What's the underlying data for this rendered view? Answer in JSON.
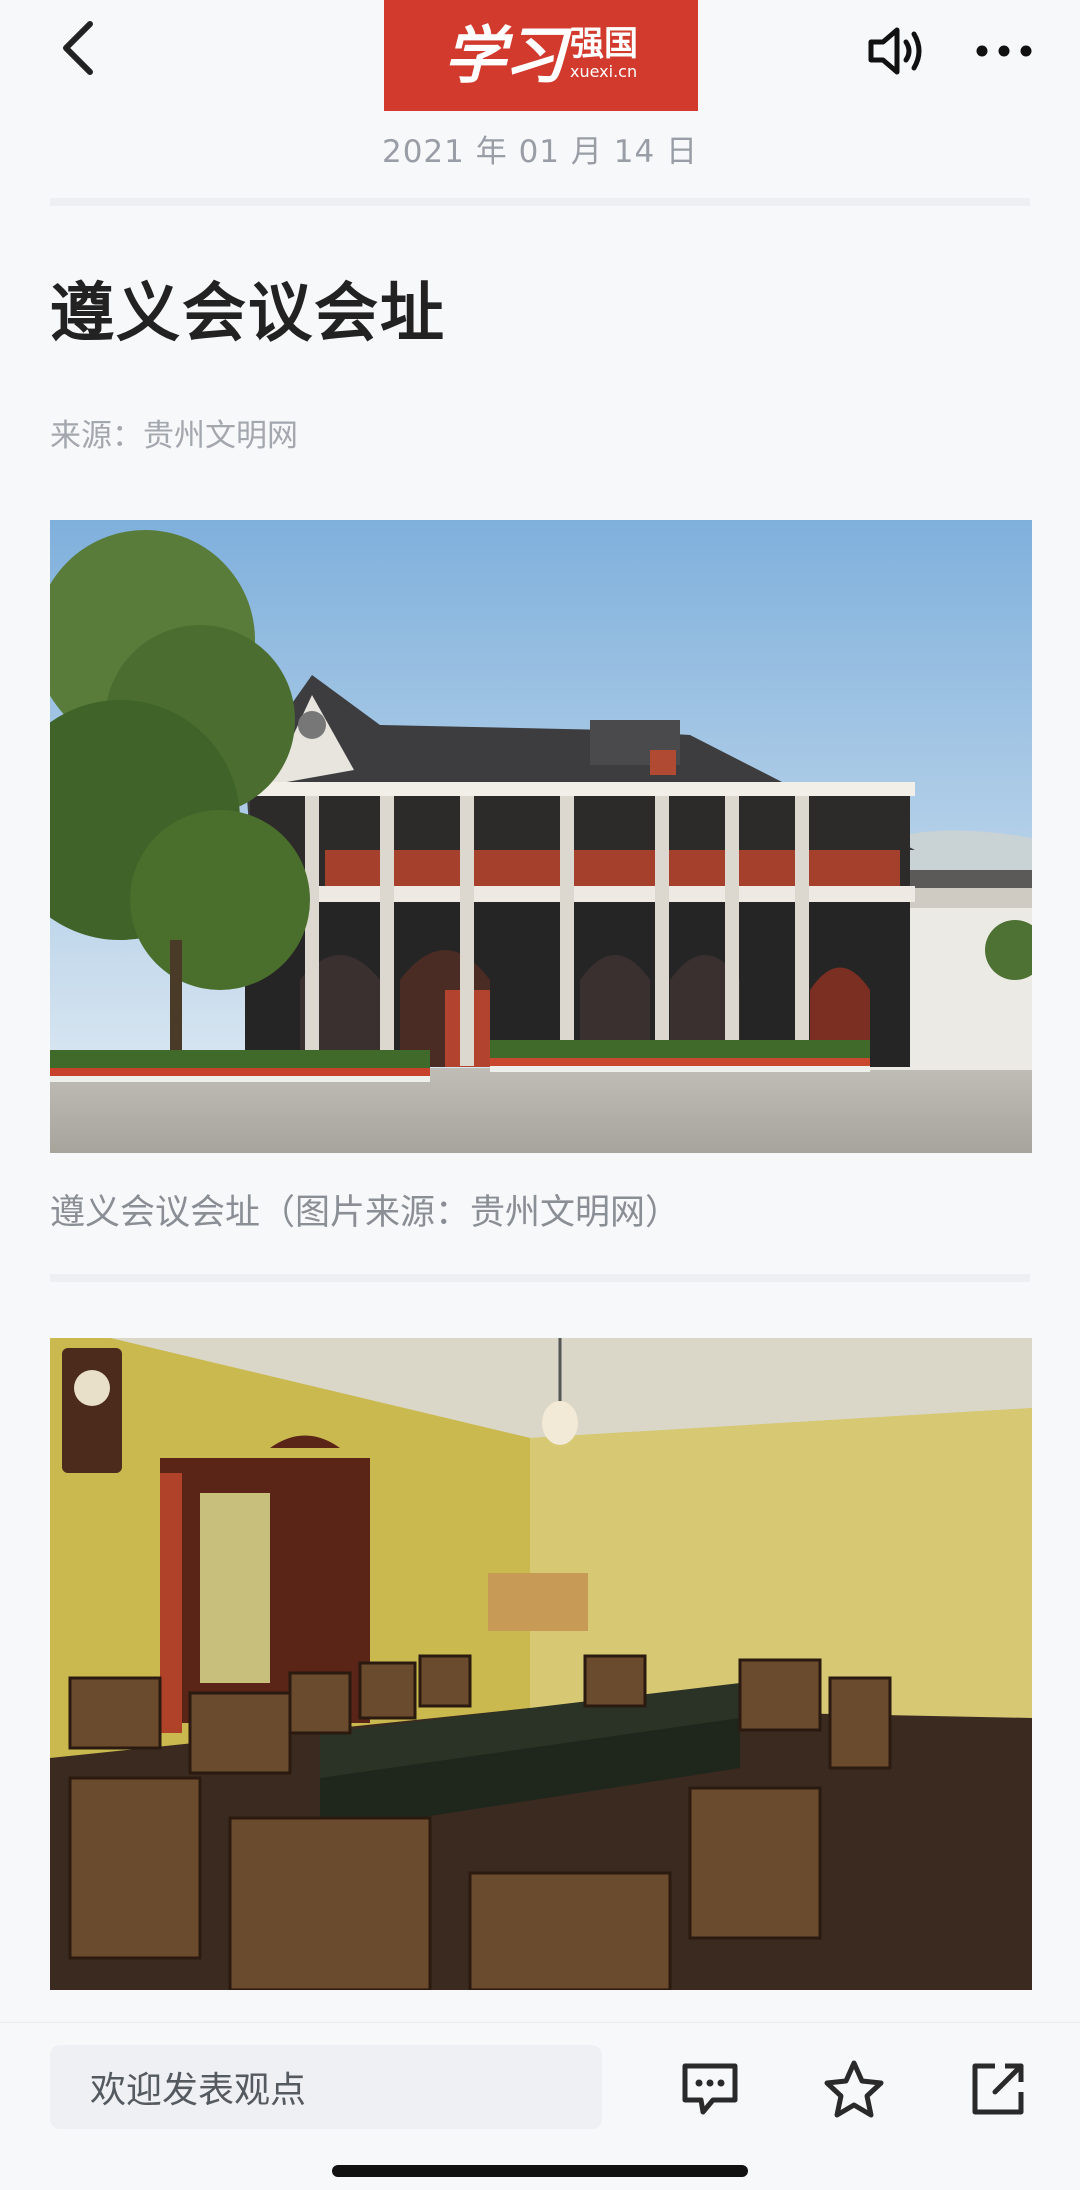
{
  "header": {
    "logo_main": "学习",
    "logo_side": "强国",
    "logo_url": "xuexi.cn",
    "date": "2021 年 01 月 14 日"
  },
  "article": {
    "title": "遵义会议会址",
    "source": "来源：贵州文明网",
    "caption1": "遵义会议会址（图片来源：贵州文明网）"
  },
  "bottom_bar": {
    "comment_placeholder": "欢迎发表观点"
  },
  "icons": {
    "back": "chevron-left-icon",
    "speaker": "speaker-icon",
    "more": "more-dots-icon",
    "comment": "comment-icon",
    "favorite": "star-icon",
    "share": "share-icon"
  },
  "colors": {
    "brand_red": "#d13a2c",
    "background": "#f7f8fa"
  }
}
